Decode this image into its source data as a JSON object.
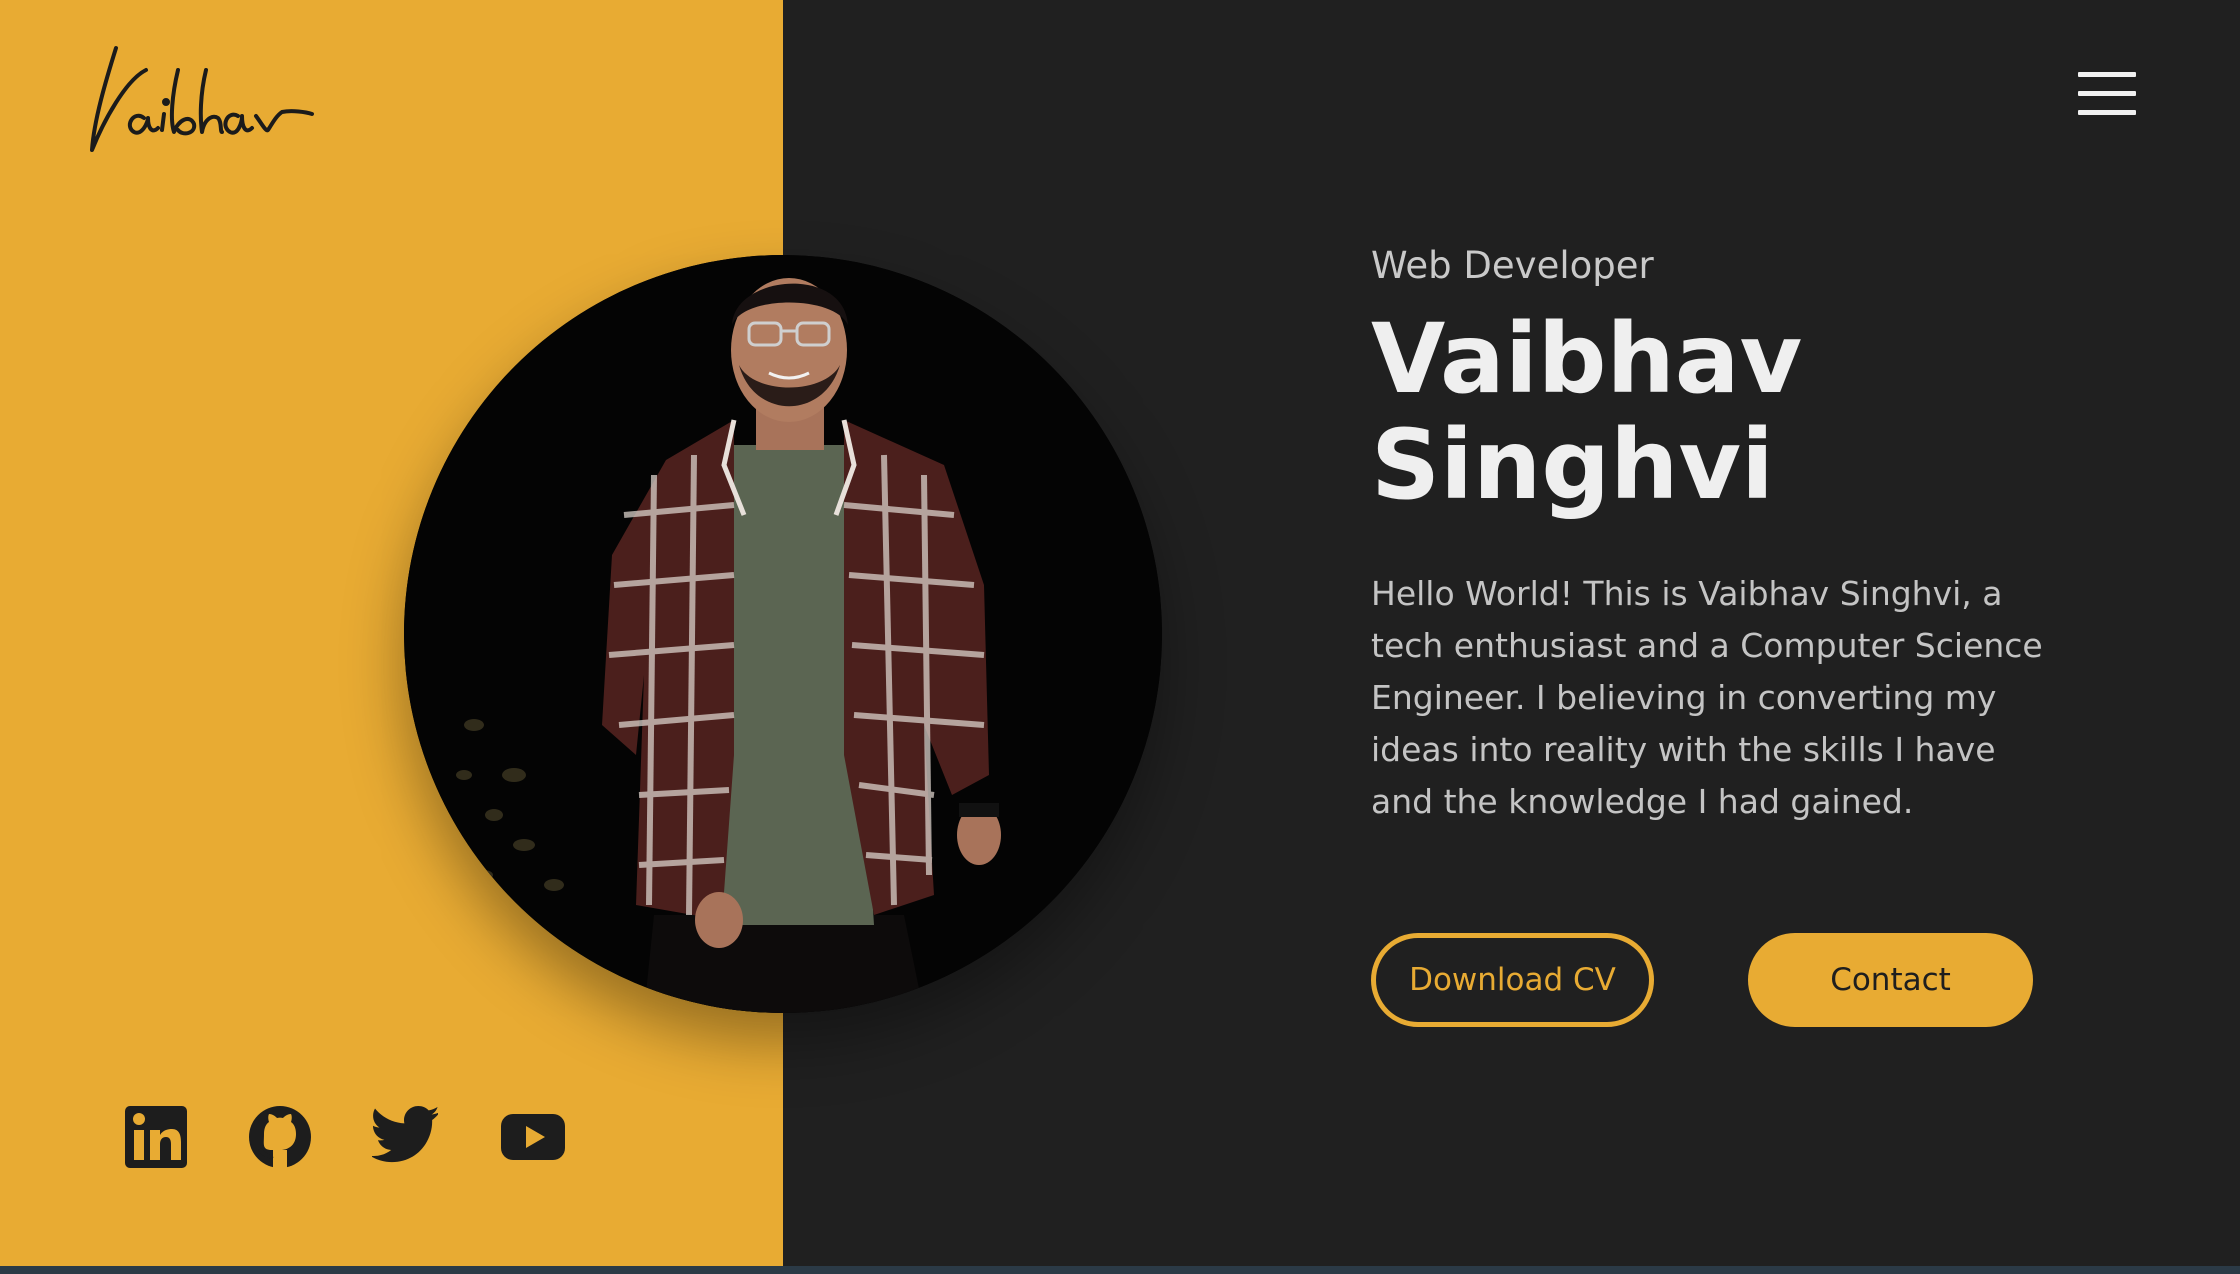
{
  "brand": {
    "logo_text": "Vaibhav"
  },
  "colors": {
    "accent": "#e8ab33",
    "dark": "#202020",
    "text_light": "#efefef",
    "text_muted": "#c4c4c4"
  },
  "nav": {
    "menu_icon": "hamburger-menu-icon"
  },
  "hero": {
    "role": "Web Developer",
    "first_name": "Vaibhav",
    "last_name": "Singhvi",
    "bio": "Hello World! This is Vaibhav Singhvi, a tech enthusiast and a Computer Science Engineer. I believing in converting my ideas into reality with the skills I have and the knowledge I had gained.",
    "download_cv_label": "Download CV",
    "contact_label": "Contact"
  },
  "social": [
    {
      "name": "linkedin",
      "icon": "linkedin-icon"
    },
    {
      "name": "github",
      "icon": "github-icon"
    },
    {
      "name": "twitter",
      "icon": "twitter-icon"
    },
    {
      "name": "youtube",
      "icon": "youtube-icon"
    }
  ]
}
